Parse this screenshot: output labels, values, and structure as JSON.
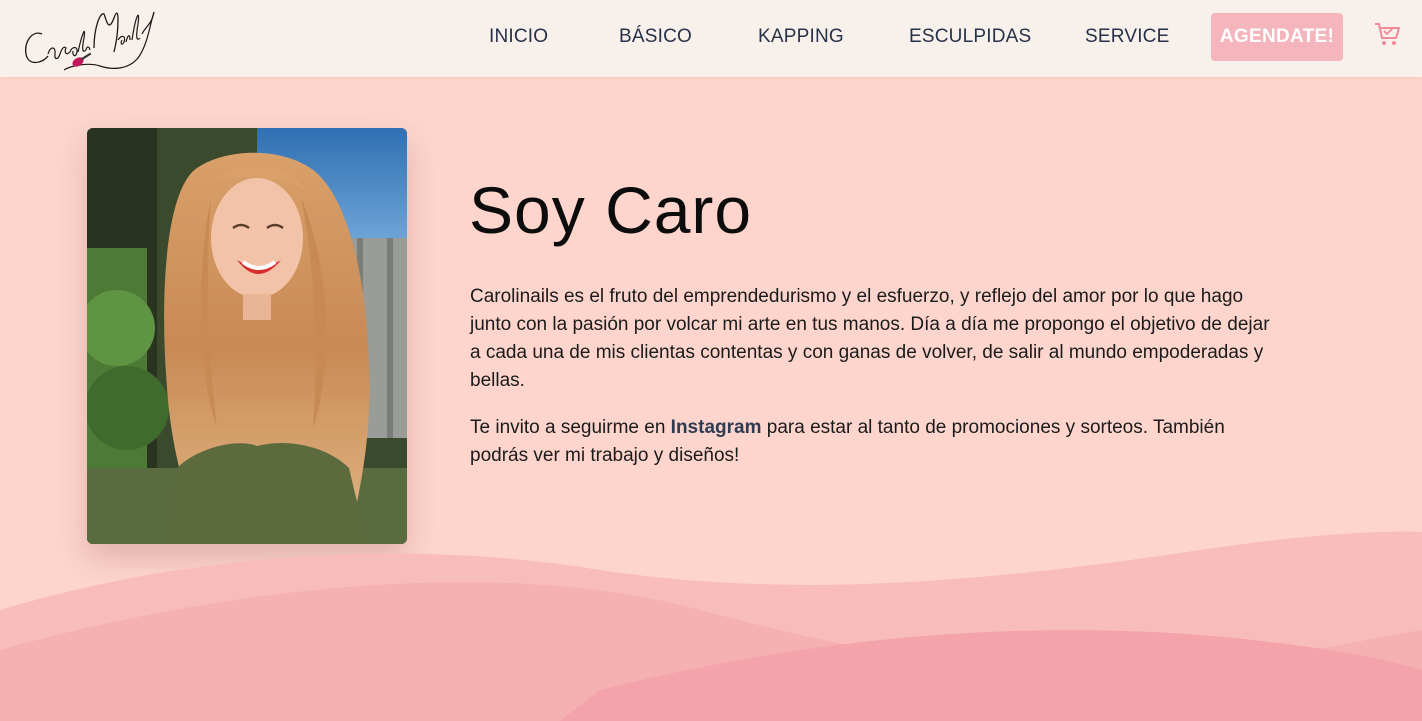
{
  "header": {
    "logo_text": "CaroliNails",
    "nav": [
      {
        "label": "INICIO"
      },
      {
        "label": "BÁSICO"
      },
      {
        "label": "KAPPING"
      },
      {
        "label": "ESCULPIDAS"
      },
      {
        "label": "SERVICE"
      }
    ],
    "cta_label": "AGENDATE!",
    "cart_icon": "shopping-cart-icon"
  },
  "about": {
    "title": "Soy Caro",
    "paragraph1": "Carolinails es el fruto del emprendedurismo y el esfuerzo, y reflejo del amor por lo que hago junto con la pasión por volcar mi arte en tus manos. Día a día me propongo el objetivo de dejar a cada una de mis clientas contentas y con ganas de volver, de salir al mundo empoderadas y bellas.",
    "paragraph2_before": "Te invito a seguirme en ",
    "instagram_link": "Instagram",
    "paragraph2_after": " para estar al tanto de promociones y sorteos. También podrás ver mi trabajo y diseños!"
  },
  "colors": {
    "background": "#fdd5cc",
    "header_bg": "#f8f0ec",
    "nav_text": "#26324a",
    "cta_bg": "#f4b5bc",
    "wave_light": "#f8bdb9",
    "wave_mid": "#f4aeb0",
    "wave_dark": "#f3a3a9"
  }
}
